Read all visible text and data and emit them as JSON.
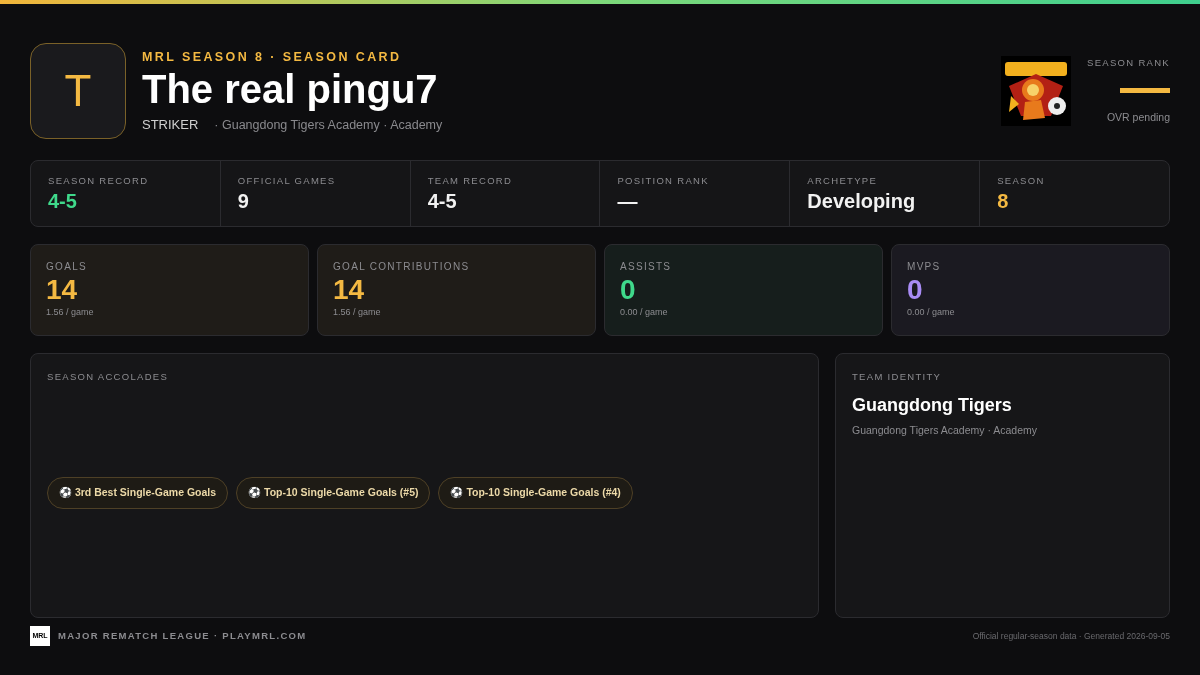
{
  "header": {
    "avatar_letter": "T",
    "eyebrow": "MRL SEASON 8 · SEASON CARD",
    "player_name": "The real pingu7",
    "position": "STRIKER",
    "affiliation": "· Guangdong Tigers Academy · Academy"
  },
  "rank": {
    "label": "SEASON RANK",
    "value_pending": true,
    "note": "OVR pending"
  },
  "summary": [
    {
      "label": "SEASON RECORD",
      "value": "4-5",
      "color": "#3fd98b"
    },
    {
      "label": "OFFICIAL GAMES",
      "value": "9",
      "color": "#f2f2f2"
    },
    {
      "label": "TEAM RECORD",
      "value": "4-5",
      "color": "#f2f2f2"
    },
    {
      "label": "POSITION RANK",
      "value": "—",
      "color": "#f2f2f2"
    },
    {
      "label": "ARCHETYPE",
      "value": "Developing",
      "color": "#f2f2f2"
    },
    {
      "label": "SEASON",
      "value": "8",
      "color": "#f4b942"
    }
  ],
  "stats": [
    {
      "label": "GOALS",
      "value": "14",
      "per_game": "1.56 / game",
      "color": "#f4b942"
    },
    {
      "label": "GOAL CONTRIBUTIONS",
      "value": "14",
      "per_game": "1.56 / game",
      "color": "#f4b942"
    },
    {
      "label": "ASSISTS",
      "value": "0",
      "per_game": "0.00 / game",
      "color": "#3fd98b"
    },
    {
      "label": "MVPS",
      "value": "0",
      "per_game": "0.00 / game",
      "color": "#a98cf5"
    }
  ],
  "accolades": {
    "title": "SEASON ACCOLADES",
    "items": [
      {
        "icon": "⚽",
        "label": "3rd Best Single-Game Goals"
      },
      {
        "icon": "⚽",
        "label": "Top-10 Single-Game Goals (#5)"
      },
      {
        "icon": "⚽",
        "label": "Top-10 Single-Game Goals (#4)"
      }
    ]
  },
  "team_identity": {
    "title": "TEAM IDENTITY",
    "team": "Guangdong Tigers",
    "subtitle": "Guangdong Tigers Academy · Academy"
  },
  "footer": {
    "logo": "MRL",
    "brand": "MAJOR REMATCH LEAGUE · PLAYMRL.COM",
    "note": "Official regular-season data · Generated 2026-09-05"
  }
}
